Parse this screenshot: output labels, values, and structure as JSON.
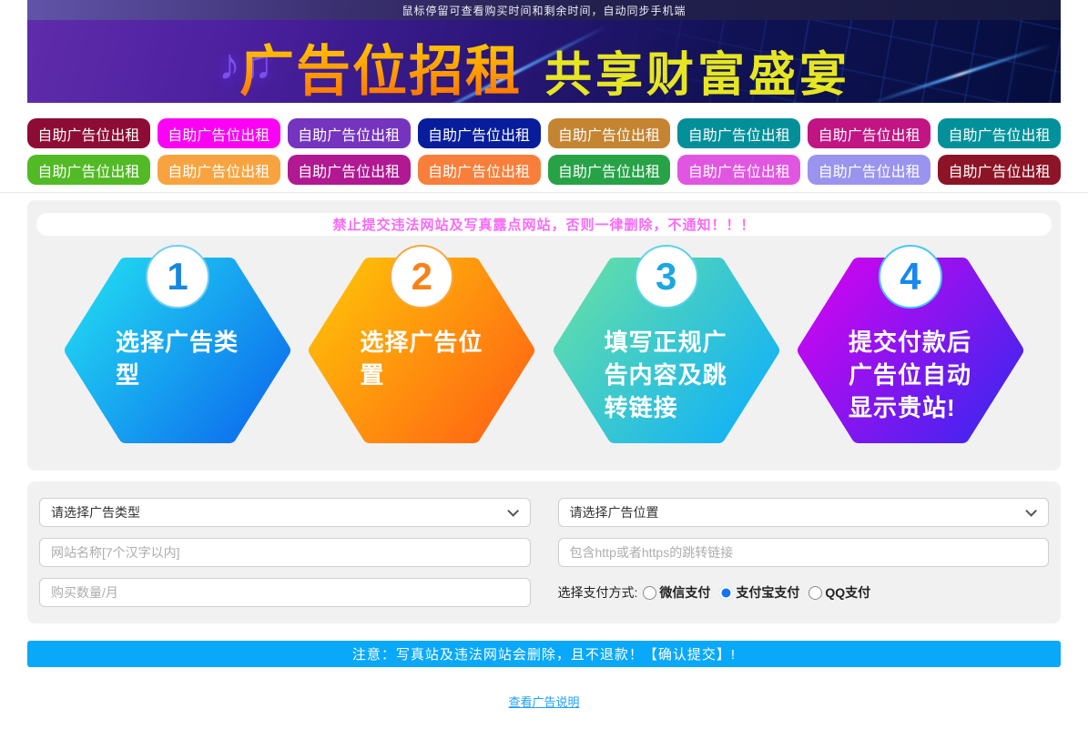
{
  "topbar": {
    "notice": "鼠标停留可查看购买时间和剩余时间，自动同步手机端"
  },
  "banner": {
    "title": "广告位招租",
    "subtitle": "共享财富盛宴",
    "music_note_icon": "♪♫"
  },
  "ad_buttons": {
    "label": "自助广告位出租",
    "colors": [
      "#8C0C35",
      "#FB02F5",
      "#7434BE",
      "#071D9B",
      "#C48431",
      "#028F99",
      "#C01583",
      "#02919B",
      "#52BA25",
      "#F7A440",
      "#B01992",
      "#F87F3B",
      "#27A247",
      "#E156E1",
      "#9A94EF",
      "#8C1426"
    ]
  },
  "warning": {
    "text": "禁止提交违法网站及写真露点网站，否则一律删除，不通知！！！"
  },
  "steps": [
    {
      "number": "1",
      "text": "选择广告类\n型",
      "gradient_from": "#23DFF2",
      "gradient_to": "#0E76EE",
      "number_color": "#1787E0",
      "ring_color": "#74CDF0"
    },
    {
      "number": "2",
      "text": "选择广告位\n置",
      "gradient_from": "#FFC508",
      "gradient_to": "#FF6D12",
      "number_color": "#F8821A",
      "ring_color": "#F8A83C"
    },
    {
      "number": "3",
      "text": "填写正规广\n告内容及跳\n转链接",
      "gradient_from": "#67E0A5",
      "gradient_to": "#17B5F2",
      "number_color": "#1BA7E0",
      "ring_color": "#57D4E8"
    },
    {
      "number": "4",
      "text": "提交付款后\n广告位自动\n显示贵站!",
      "gradient_from": "#D703F0",
      "gradient_to": "#4A23EF",
      "number_color": "#1787F0",
      "ring_color": "#49C8F0"
    }
  ],
  "form": {
    "type_select_value": "请选择广告类型",
    "position_select_value": "请选择广告位置",
    "site_name_placeholder": "网站名称[7个汉字以内]",
    "link_placeholder": "包含http或者https的跳转链接",
    "quantity_placeholder": "购买数量/月",
    "payment_label": "选择支付方式:",
    "payment_options": [
      {
        "label": "微信支付",
        "checked": false
      },
      {
        "label": "支付宝支付",
        "checked": true
      },
      {
        "label": "QQ支付",
        "checked": false
      }
    ]
  },
  "submit": {
    "text": "注意：写真站及违法网站会删除，且不退款！【确认提交】!"
  },
  "footer": {
    "link": "查看广告说明"
  }
}
